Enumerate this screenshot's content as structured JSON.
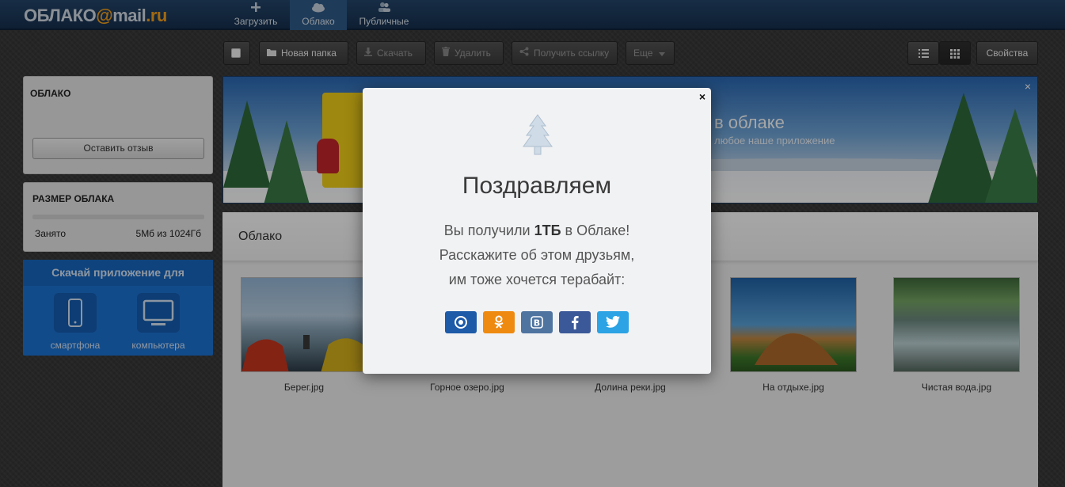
{
  "logo": {
    "text_cloud": "ОБЛАКО",
    "text_at": "@",
    "text_mail": "mail",
    "text_dot": ".ru"
  },
  "nav": [
    {
      "label": "Загрузить",
      "icon": "plus-icon"
    },
    {
      "label": "Облако",
      "icon": "cloud-icon"
    },
    {
      "label": "Публичные",
      "icon": "users-icon"
    }
  ],
  "toolbar": {
    "new_folder": "Новая папка",
    "download": "Скачать",
    "delete": "Удалить",
    "get_link": "Получить ссылку",
    "more": "Еще",
    "properties": "Свойства"
  },
  "sidebar": {
    "cloud_title": "ОБЛАКО",
    "feedback_button": "Оставить отзыв",
    "size_title": "РАЗМЕР ОБЛАКА",
    "used_label": "Занято",
    "used_value": "5Мб из 1024Гб",
    "app_header": "Скачай приложение для",
    "app_smartphone": "смартфона",
    "app_computer": "компьютера"
  },
  "banner": {
    "title": "в облаке",
    "subtitle": "любое наше приложение",
    "close": "×"
  },
  "content": {
    "title": "Облако",
    "files": [
      {
        "name": "Берег.jpg"
      },
      {
        "name": "Горное озеро.jpg"
      },
      {
        "name": "Долина реки.jpg"
      },
      {
        "name": "На отдыхе.jpg"
      },
      {
        "name": "Чистая вода.jpg"
      }
    ]
  },
  "modal": {
    "close": "×",
    "title": "Поздравляем",
    "line1_pre": "Вы получили ",
    "line1_bold": "1ТБ",
    "line1_post": " в Облаке!",
    "line2": "Расскажите об этом друзьям,",
    "line3": "им тоже хочется терабайт:",
    "share": [
      {
        "network": "mail-ru",
        "glyph": "@"
      },
      {
        "network": "odnoklassniki",
        "glyph": "ok"
      },
      {
        "network": "vkontakte",
        "glyph": "B"
      },
      {
        "network": "facebook",
        "glyph": "f"
      },
      {
        "network": "twitter",
        "glyph": "t"
      }
    ]
  },
  "colors": {
    "header_bg": "#1c3a5c",
    "accent_orange": "#f7a21a",
    "app_blue": "#1d73d4"
  }
}
